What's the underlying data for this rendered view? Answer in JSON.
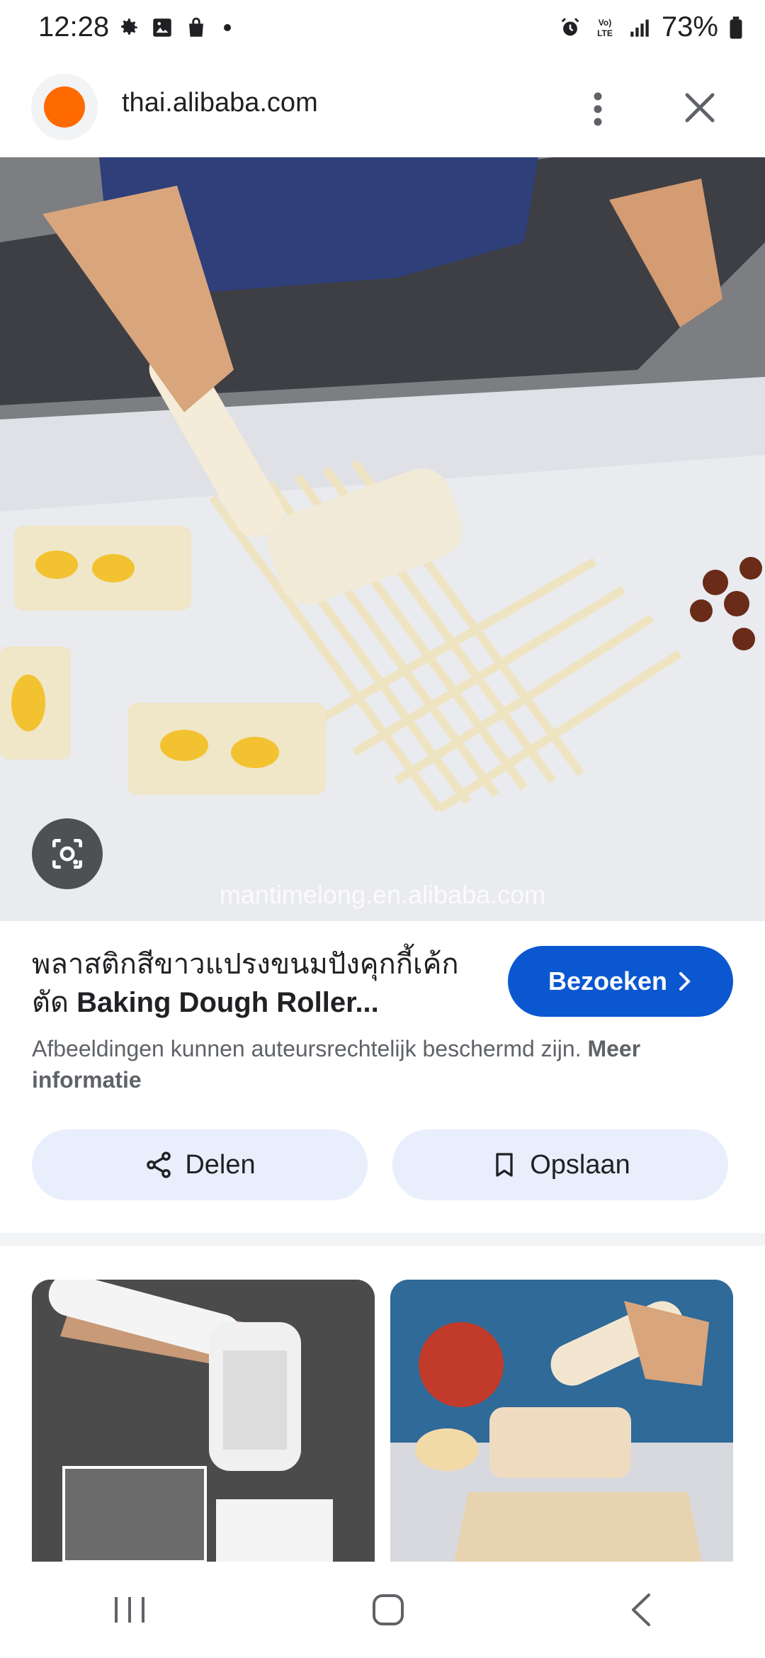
{
  "status_bar": {
    "time": "12:28",
    "battery": "73%"
  },
  "url_bar": {
    "domain": "thai.alibaba.com"
  },
  "image": {
    "watermark": "mantimelong.en.alibaba.com"
  },
  "result": {
    "title_thai": "พลาสติกสีขาวแปรงขนมปังคุกกี้เค้กตัด ",
    "title_english": "Baking Dough Roller...",
    "visit_label": "Bezoeken",
    "copyright_text": "Afbeeldingen kunnen auteursrechtelijk beschermd zijn. ",
    "copyright_link": "Meer informatie"
  },
  "actions": {
    "share_label": "Delen",
    "save_label": "Opslaan"
  },
  "colors": {
    "accent": "#0b57d0",
    "chip_bg": "#e8eefb",
    "favicon": "#ff6a00"
  }
}
